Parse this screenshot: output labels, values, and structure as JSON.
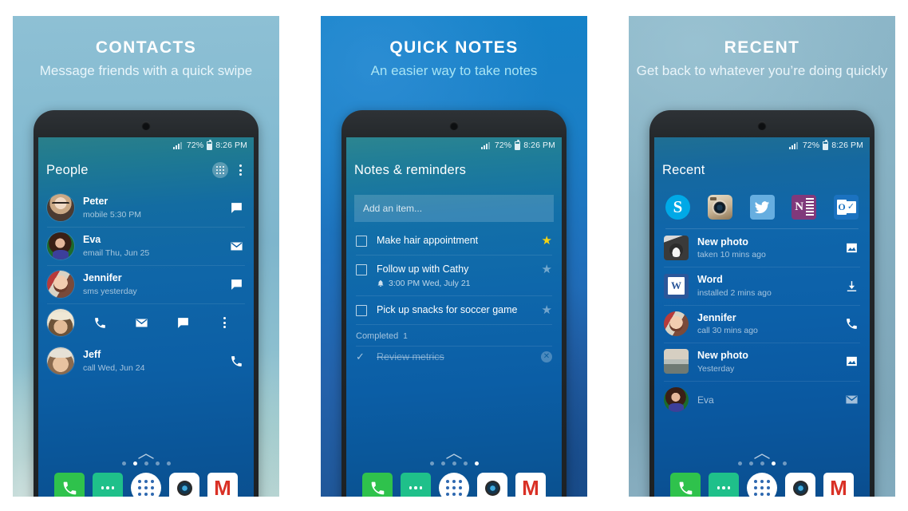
{
  "panels": [
    {
      "id": "contacts",
      "title": "CONTACTS",
      "subtitle": "Message friends with a quick swipe",
      "status": {
        "battery": "72%",
        "time": "8:26 PM"
      },
      "appbar": {
        "title": "People",
        "dialpad_icon": "dialpad-icon",
        "overflow_icon": "overflow-menu-icon"
      },
      "contacts": [
        {
          "name": "Peter",
          "detail": "mobile 5:30 PM",
          "action_icon": "message-icon",
          "avatar": "av-peter"
        },
        {
          "name": "Eva",
          "detail": "email Thu, Jun 25",
          "action_icon": "mail-icon",
          "avatar": "av-eva"
        },
        {
          "name": "Jennifer",
          "detail": "sms yesterday",
          "action_icon": "message-icon",
          "avatar": "av-jen"
        }
      ],
      "expanded_row": {
        "avatar": "av-hat",
        "actions": [
          "call-icon",
          "mail-icon",
          "message-icon",
          "overflow-menu-icon"
        ]
      },
      "contacts_tail": [
        {
          "name": "Jeff",
          "detail": "call Wed, Jun 24",
          "action_icon": "call-icon",
          "avatar": "av-jeff"
        }
      ],
      "home": {
        "dots": 5,
        "active_dot": 2
      }
    },
    {
      "id": "notes",
      "title": "QUICK NOTES",
      "subtitle": "An easier way to take notes",
      "status": {
        "battery": "72%",
        "time": "8:26 PM"
      },
      "appbar": {
        "title": "Notes & reminders"
      },
      "add_placeholder": "Add an item...",
      "tasks": [
        {
          "text": "Make hair appointment",
          "reminder": "",
          "starred": true
        },
        {
          "text": "Follow up with Cathy",
          "reminder": "3:00 PM Wed, July 21",
          "starred": false
        },
        {
          "text": "Pick up snacks for soccer game",
          "reminder": "",
          "starred": false
        }
      ],
      "completed_label": "Completed",
      "completed_count": "1",
      "completed_items": [
        {
          "text": "Review metrics"
        }
      ],
      "home": {
        "dots": 5,
        "active_dot": 5
      }
    },
    {
      "id": "recent",
      "title": "RECENT",
      "subtitle": "Get back to whatever you’re doing quickly",
      "status": {
        "battery": "72%",
        "time": "8:26 PM"
      },
      "appbar": {
        "title": "Recent"
      },
      "apps": [
        {
          "name": "skype-icon",
          "label": "Skype"
        },
        {
          "name": "instagram-icon",
          "label": "Instagram"
        },
        {
          "name": "twitter-icon",
          "label": "Twitter"
        },
        {
          "name": "onenote-icon",
          "label": "OneNote",
          "letter": "N"
        },
        {
          "name": "outlook-icon",
          "label": "Outlook",
          "letter": "O"
        }
      ],
      "items": [
        {
          "title": "New photo",
          "detail": "taken 10 mins ago",
          "action_icon": "photo-icon",
          "thumb": "av-dog",
          "shape": "square"
        },
        {
          "title": "Word",
          "detail": "installed 2 mins ago",
          "action_icon": "download-icon",
          "thumb": "tile-word",
          "shape": "square",
          "letter": "W"
        },
        {
          "title": "Jennifer",
          "detail": "call 30 mins ago",
          "action_icon": "call-icon",
          "thumb": "av-jen",
          "shape": "circle"
        },
        {
          "title": "New photo",
          "detail": "Yesterday",
          "action_icon": "photo-icon",
          "thumb": "av-land",
          "shape": "square"
        },
        {
          "title": "Eva",
          "detail": "",
          "action_icon": "mail-icon",
          "thumb": "av-eva",
          "shape": "circle"
        }
      ],
      "home": {
        "dots": 5,
        "active_dot": 4
      }
    }
  ],
  "dock": {
    "items": [
      {
        "name": "phone-dock-icon",
        "label": "Phone"
      },
      {
        "name": "messages-dock-icon",
        "label": "Messages"
      },
      {
        "name": "app-drawer-dock-icon",
        "label": "Apps"
      },
      {
        "name": "camera-dock-icon",
        "label": "Camera"
      },
      {
        "name": "gmail-dock-icon",
        "label": "Gmail",
        "glyph": "M"
      }
    ]
  },
  "colors": {
    "star_active": "#f5d313",
    "dock_phone": "#2fc24c",
    "dock_messages": "#1fc08a",
    "gmail_red": "#d93025",
    "notes_subtitle": "#a7e4f4"
  }
}
